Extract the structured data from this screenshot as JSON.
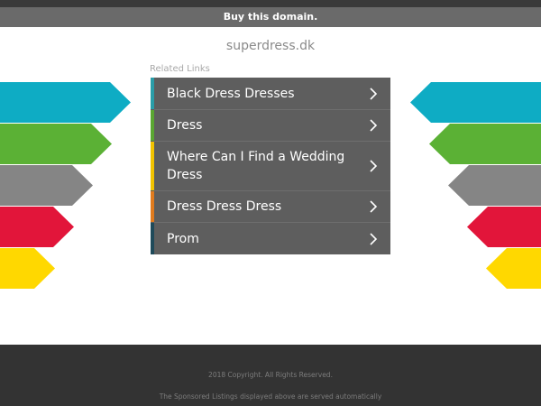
{
  "banner": {
    "label": "Buy this domain."
  },
  "domain": "superdress.dk",
  "related_links": {
    "heading": "Related Links",
    "items": [
      {
        "label": "Black Dress Dresses",
        "accent": "#2a9da8"
      },
      {
        "label": "Dress",
        "accent": "#5aa632"
      },
      {
        "label": "Where Can I Find a Wedding Dress",
        "accent": "#f2c300"
      },
      {
        "label": "Dress Dress Dress",
        "accent": "#e07b1e"
      },
      {
        "label": "Prom",
        "accent": "#1f4a5a"
      }
    ],
    "chevron_icon": "chevron-right-icon"
  },
  "decor": {
    "stripe_colors": [
      "#0eacc4",
      "#5bb135",
      "#858585",
      "#e2153a",
      "#ffd800"
    ]
  },
  "footer": {
    "copyright": "2018 Copyright. All Rights Reserved.",
    "notice": "The Sponsored Listings displayed above are served automatically"
  }
}
